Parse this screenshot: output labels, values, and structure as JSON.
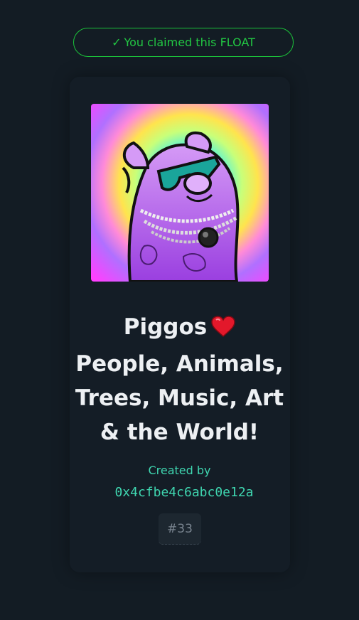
{
  "claim_banner": {
    "check": "✓",
    "text": "You claimed this FLOAT",
    "color": "#22c743"
  },
  "float": {
    "image_alt": "Piggos",
    "title_lines": [
      "Piggos",
      "People, Animals,",
      "Trees, Music, Art",
      "& the World!"
    ],
    "title_emoji": "heart-icon",
    "created_by_label": "Created by",
    "creator_address": "0x4cfbe4c6abc0e12a",
    "serial": "#33"
  },
  "colors": {
    "background": "#131c24",
    "accent": "#3fd6b0",
    "success": "#22c743"
  }
}
